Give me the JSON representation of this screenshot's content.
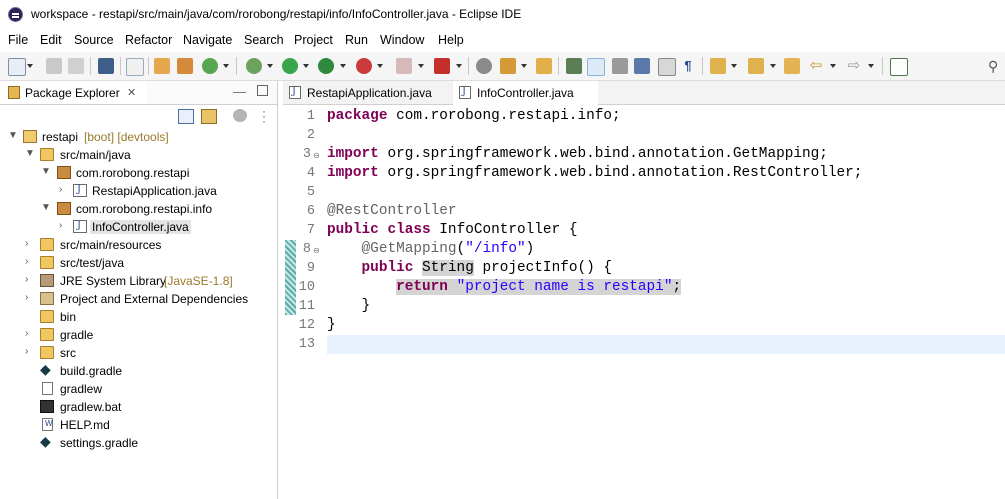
{
  "window": {
    "title": "workspace - restapi/src/main/java/com/rorobong/restapi/info/InfoController.java - Eclipse IDE"
  },
  "menu": [
    "File",
    "Edit",
    "Source",
    "Refactor",
    "Navigate",
    "Search",
    "Project",
    "Run",
    "Window",
    "Help"
  ],
  "explorer": {
    "tab_label": "Package Explorer",
    "tree": [
      {
        "label": "restapi",
        "decor": "[boot] [devtools]"
      },
      {
        "label": "src/main/java"
      },
      {
        "label": "com.rorobong.restapi"
      },
      {
        "label": "RestapiApplication.java"
      },
      {
        "label": "com.rorobong.restapi.info"
      },
      {
        "label": "InfoController.java"
      },
      {
        "label": "src/main/resources"
      },
      {
        "label": "src/test/java"
      },
      {
        "label": "JRE System Library",
        "decor": "[JavaSE-1.8]"
      },
      {
        "label": "Project and External Dependencies"
      },
      {
        "label": "bin"
      },
      {
        "label": "gradle"
      },
      {
        "label": "src"
      },
      {
        "label": "build.gradle"
      },
      {
        "label": "gradlew"
      },
      {
        "label": "gradlew.bat"
      },
      {
        "label": "HELP.md"
      },
      {
        "label": "settings.gradle"
      }
    ]
  },
  "editor": {
    "tabs": [
      {
        "label": "RestapiApplication.java"
      },
      {
        "label": "InfoController.java"
      }
    ],
    "line_numbers": [
      "1",
      "2",
      "3",
      "4",
      "5",
      "6",
      "7",
      "8",
      "9",
      "10",
      "11",
      "12",
      "13"
    ],
    "code": {
      "l1_kw": "package",
      "l1_rest": " com.rorobong.restapi.info;",
      "l3_kw": "import",
      "l3_rest": " org.springframework.web.bind.annotation.GetMapping;",
      "l4_kw": "import",
      "l4_rest": " org.springframework.web.bind.annotation.RestController;",
      "l6_ann": "@RestController",
      "l7_kw1": "public",
      "l7_kw2": "class",
      "l7_rest": " InfoController {",
      "l8_ann": "@GetMapping",
      "l8_open": "(",
      "l8_str": "\"/info\"",
      "l8_close": ")",
      "l9_kw": "public",
      "l9_type": "String",
      "l9_rest": " projectInfo() {",
      "l10_kw": "return",
      "l10_str": "\"project name is restapi\"",
      "l10_semi": ";",
      "l11": "    }",
      "l12": "}"
    }
  }
}
